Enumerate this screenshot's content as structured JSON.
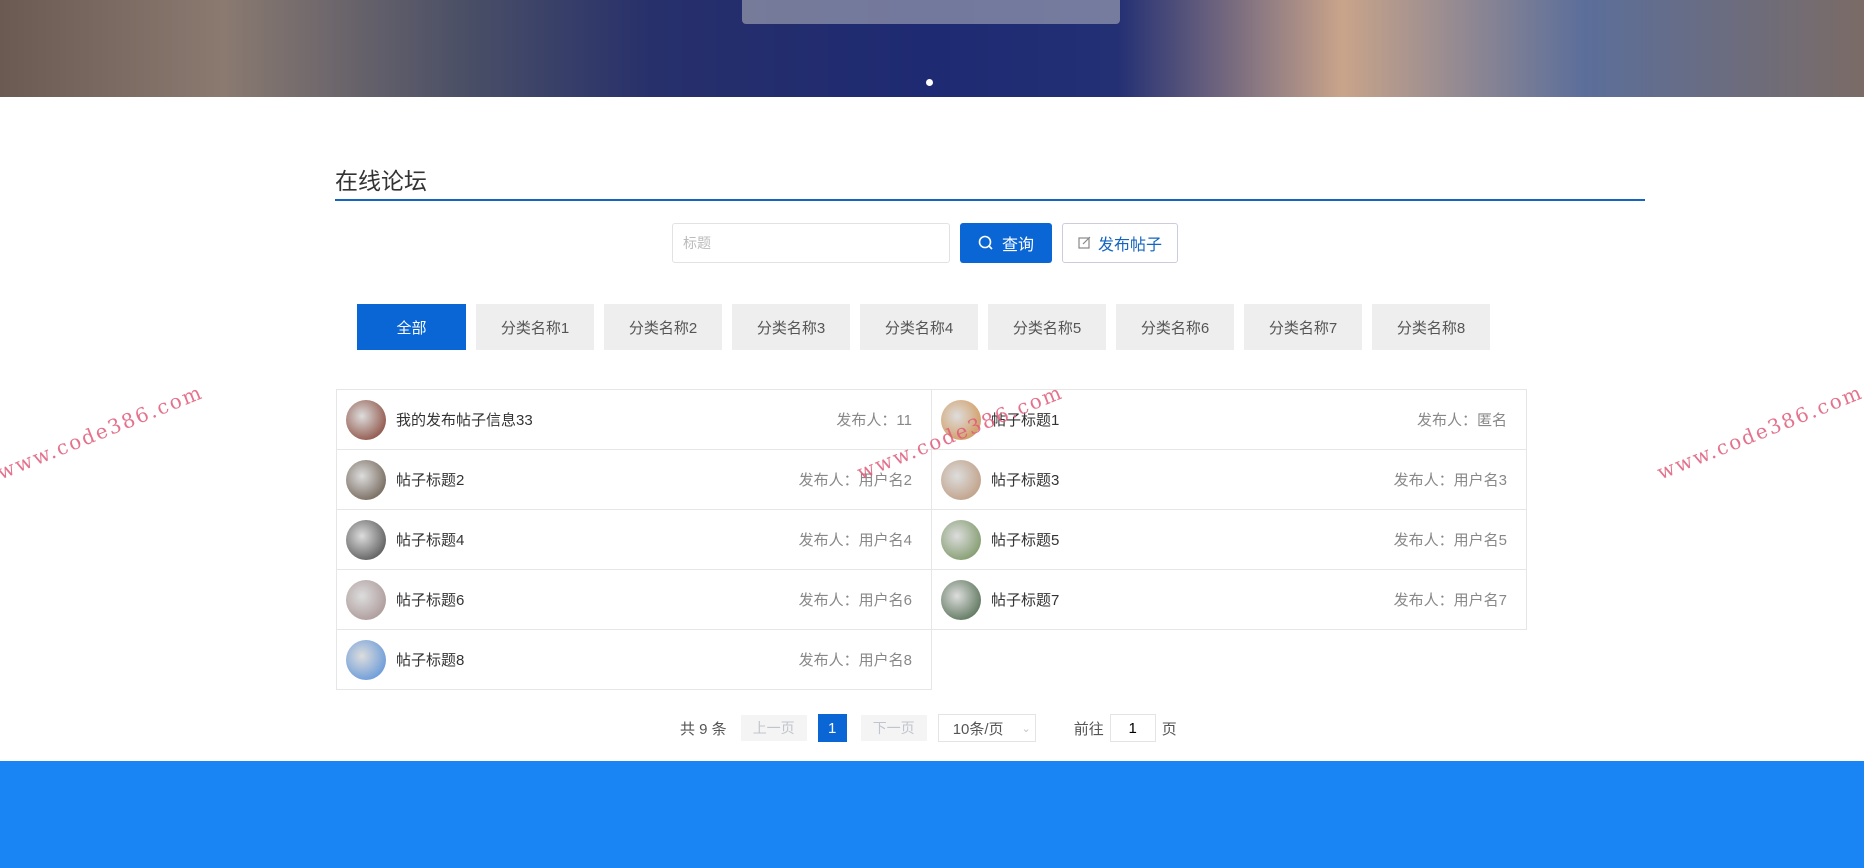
{
  "title": "在线论坛",
  "search": {
    "placeholder": "标题",
    "query_label": "查询",
    "publish_label": "发布帖子"
  },
  "categories": [
    "全部",
    "分类名称1",
    "分类名称2",
    "分类名称3",
    "分类名称4",
    "分类名称5",
    "分类名称6",
    "分类名称7",
    "分类名称8"
  ],
  "posts": [
    {
      "title": "我的发布帖子信息33",
      "author": "发布人：11",
      "color": "#7a3020"
    },
    {
      "title": "帖子标题1",
      "author": "发布人：匿名",
      "color": "#d08a40"
    },
    {
      "title": "帖子标题2",
      "author": "发布人：用户名2",
      "color": "#5a4a3a"
    },
    {
      "title": "帖子标题3",
      "author": "发布人：用户名3",
      "color": "#b89070"
    },
    {
      "title": "帖子标题4",
      "author": "发布人：用户名4",
      "color": "#3a3a3a"
    },
    {
      "title": "帖子标题5",
      "author": "发布人：用户名5",
      "color": "#6a8a50"
    },
    {
      "title": "帖子标题6",
      "author": "发布人：用户名6",
      "color": "#a08888"
    },
    {
      "title": "帖子标题7",
      "author": "发布人：用户名7",
      "color": "#3a5a3a"
    },
    {
      "title": "帖子标题8",
      "author": "发布人：用户名8",
      "color": "#4a88d8"
    }
  ],
  "pagination": {
    "total": "共 9 条",
    "prev": "上一页",
    "current": "1",
    "next": "下一页",
    "page_size": "10条/页",
    "goto": "前往",
    "goto_value": "1",
    "page_unit": "页"
  },
  "watermark": "www.code386.com"
}
